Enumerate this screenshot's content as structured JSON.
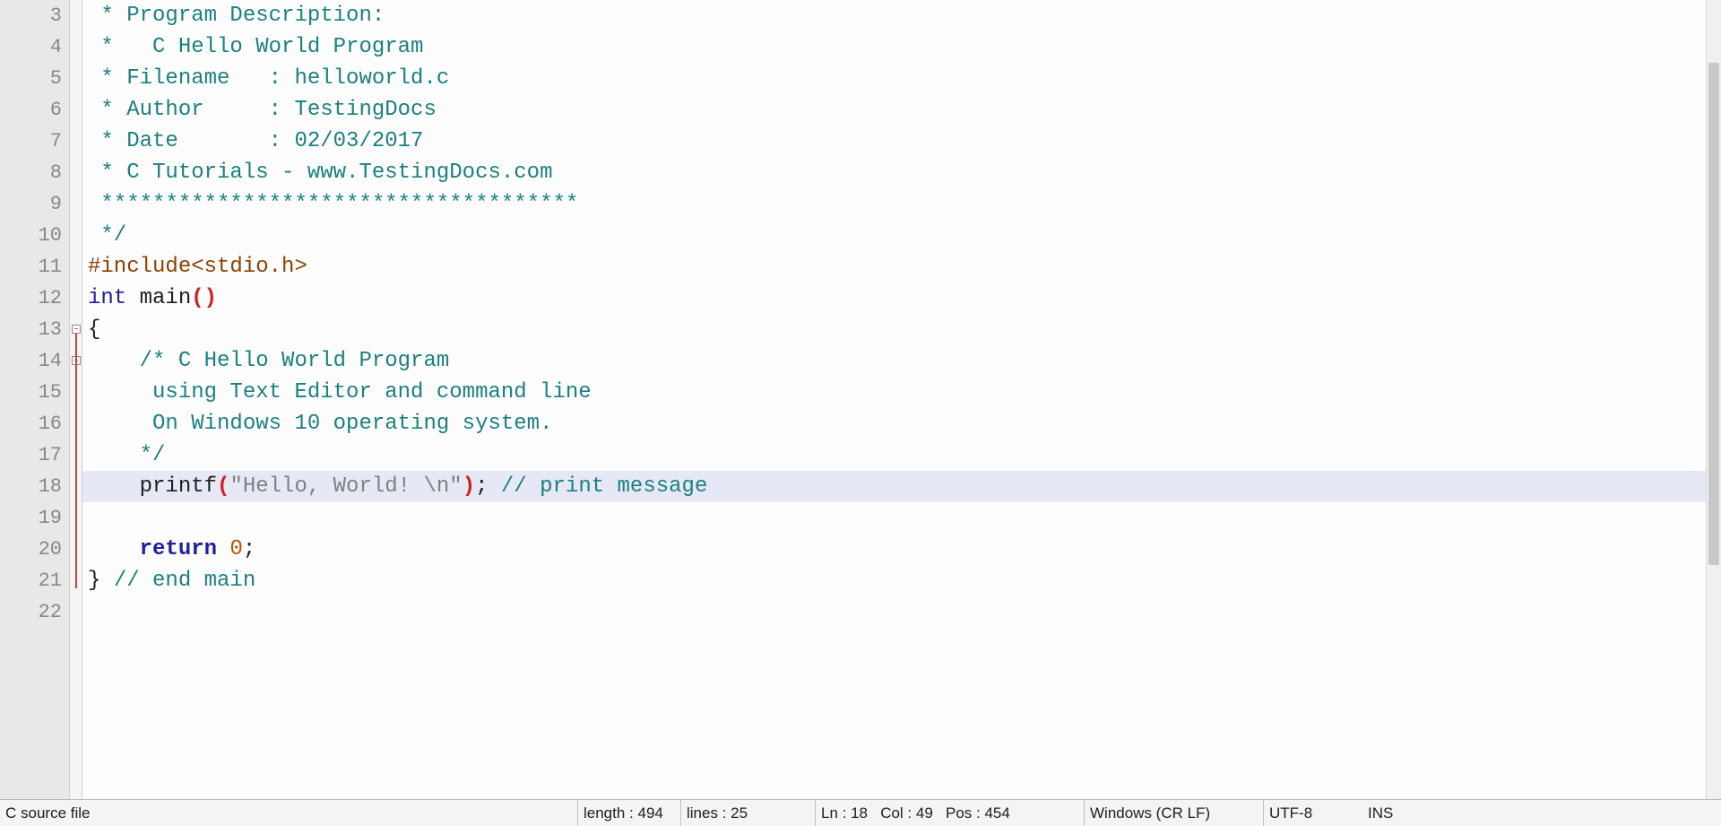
{
  "lines": [
    {
      "num": 3,
      "tokens": [
        {
          "cls": "c-comment",
          "t": " * Program Description:"
        }
      ]
    },
    {
      "num": 4,
      "tokens": [
        {
          "cls": "c-comment",
          "t": " *   C Hello World Program"
        }
      ]
    },
    {
      "num": 5,
      "tokens": [
        {
          "cls": "c-comment",
          "t": " * Filename   : helloworld.c"
        }
      ]
    },
    {
      "num": 6,
      "tokens": [
        {
          "cls": "c-comment",
          "t": " * Author     : TestingDocs"
        }
      ]
    },
    {
      "num": 7,
      "tokens": [
        {
          "cls": "c-comment",
          "t": " * Date       : 02/03/2017"
        }
      ]
    },
    {
      "num": 8,
      "tokens": [
        {
          "cls": "c-comment",
          "t": " * C Tutorials - www.TestingDocs.com"
        }
      ]
    },
    {
      "num": 9,
      "tokens": [
        {
          "cls": "c-comment",
          "t": " *************************************"
        }
      ]
    },
    {
      "num": 10,
      "tokens": [
        {
          "cls": "c-comment",
          "t": " */"
        }
      ]
    },
    {
      "num": 11,
      "tokens": [
        {
          "cls": "c-preproc",
          "t": "#include<stdio.h>"
        }
      ]
    },
    {
      "num": 12,
      "tokens": [
        {
          "cls": "c-keyword-int",
          "t": "int"
        },
        {
          "cls": "c-plain",
          "t": " "
        },
        {
          "cls": "c-func",
          "t": "main"
        },
        {
          "cls": "c-paren",
          "t": "()"
        }
      ]
    },
    {
      "num": 13,
      "fold": "open",
      "tokens": [
        {
          "cls": "c-brace",
          "t": "{"
        }
      ]
    },
    {
      "num": 14,
      "fold": "open",
      "tokens": [
        {
          "cls": "c-comment",
          "t": "    /* C Hello World Program"
        }
      ]
    },
    {
      "num": 15,
      "tokens": [
        {
          "cls": "c-comment",
          "t": "     using Text Editor and command line"
        }
      ]
    },
    {
      "num": 16,
      "tokens": [
        {
          "cls": "c-comment",
          "t": "     On Windows 10 operating system."
        }
      ]
    },
    {
      "num": 17,
      "tokens": [
        {
          "cls": "c-comment",
          "t": "    */"
        }
      ]
    },
    {
      "num": 18,
      "hl": true,
      "tokens": [
        {
          "cls": "c-plain",
          "t": "    "
        },
        {
          "cls": "c-func",
          "t": "printf"
        },
        {
          "cls": "c-paren",
          "t": "("
        },
        {
          "cls": "c-string",
          "t": "\"Hello, World! \\n\""
        },
        {
          "cls": "c-paren",
          "t": ")"
        },
        {
          "cls": "c-plain",
          "t": "; "
        },
        {
          "cls": "c-line-comment",
          "t": "// print message"
        }
      ]
    },
    {
      "num": 19,
      "tokens": []
    },
    {
      "num": 20,
      "tokens": [
        {
          "cls": "c-plain",
          "t": "    "
        },
        {
          "cls": "c-keyword-return",
          "t": "return"
        },
        {
          "cls": "c-plain",
          "t": " "
        },
        {
          "cls": "c-number",
          "t": "0"
        },
        {
          "cls": "c-plain",
          "t": ";"
        }
      ]
    },
    {
      "num": 21,
      "tokens": [
        {
          "cls": "c-brace",
          "t": "}"
        },
        {
          "cls": "c-plain",
          "t": " "
        },
        {
          "cls": "c-line-comment",
          "t": "// end main"
        }
      ]
    },
    {
      "num": 22,
      "tokens": []
    }
  ],
  "fold_lines": [
    {
      "start_idx": 10,
      "end_idx": 18
    }
  ],
  "status": {
    "filetype": "C source file",
    "length_label": "length :",
    "length_value": "494",
    "lines_label": "lines :",
    "lines_value": "25",
    "ln_label": "Ln :",
    "ln_value": "18",
    "col_label": "Col :",
    "col_value": "49",
    "pos_label": "Pos :",
    "pos_value": "454",
    "eol": "Windows (CR LF)",
    "encoding": "UTF-8",
    "insert_mode": "INS"
  }
}
